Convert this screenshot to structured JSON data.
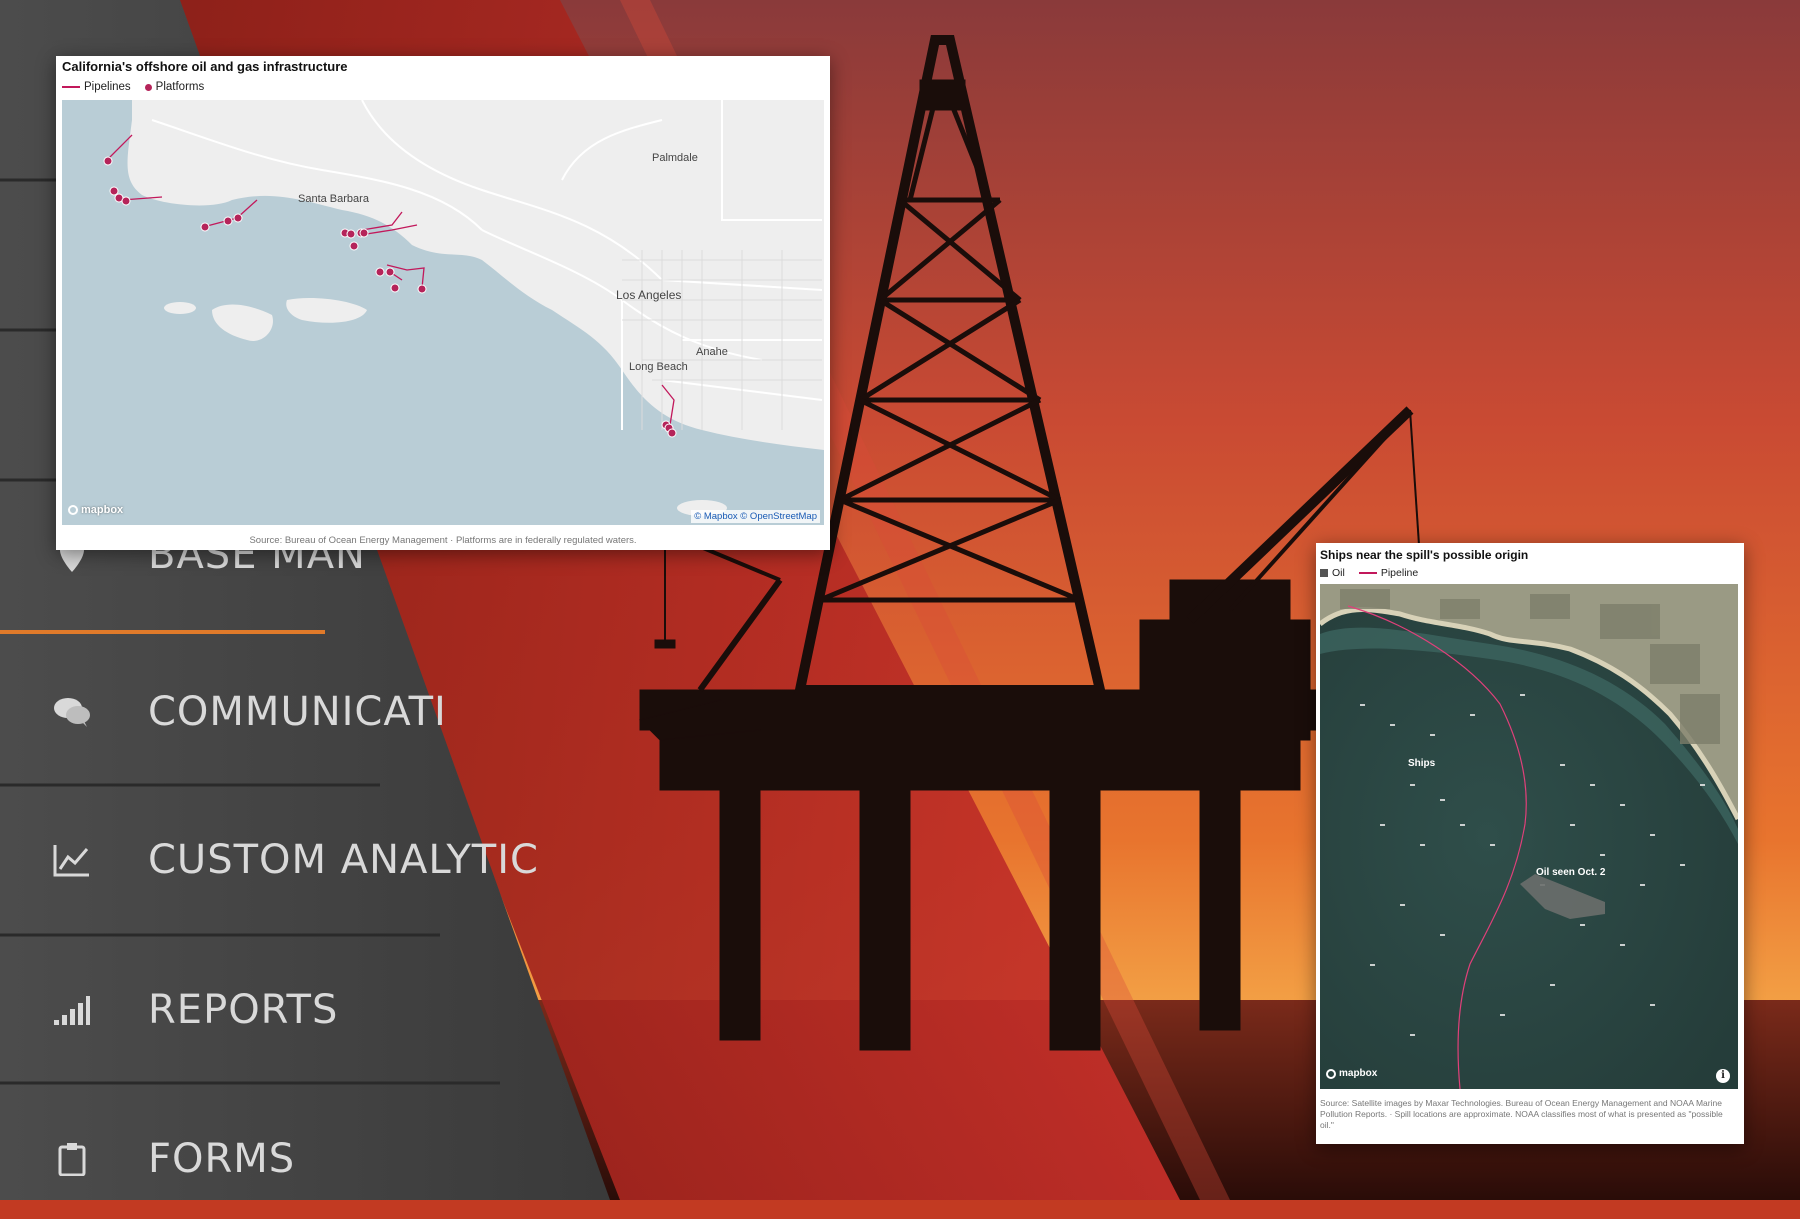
{
  "menu": {
    "items": [
      {
        "label": "BASE MAN",
        "icon": "map-pin-icon"
      },
      {
        "label": "COMMUNICATI",
        "icon": "chat-bubbles-icon"
      },
      {
        "label": "CUSTOM ANALYTIC",
        "icon": "line-chart-icon"
      },
      {
        "label": "REPORTS",
        "icon": "signal-bars-icon"
      },
      {
        "label": "FORMS",
        "icon": "clipboard-icon"
      }
    ]
  },
  "map1": {
    "title": "California's offshore oil and gas infrastructure",
    "legend": {
      "pipelines": "Pipelines",
      "platforms": "Platforms"
    },
    "cities": {
      "palmdale": "Palmdale",
      "santa_barbara": "Santa Barbara",
      "los_angeles": "Los Angeles",
      "anaheim": "Anahe",
      "long_beach": "Long Beach"
    },
    "mapbox": "mapbox",
    "attribution": "© Mapbox © OpenStreetMap",
    "source": "Source: Bureau of Ocean Energy Management  ·  Platforms are in federally regulated waters."
  },
  "map2": {
    "title": "Ships near the spill's possible origin",
    "legend": {
      "oil": "Oil",
      "pipeline": "Pipeline"
    },
    "annotations": {
      "ships": "Ships",
      "oil_seen": "Oil seen Oct. 2"
    },
    "mapbox": "mapbox",
    "info": "i",
    "source": "Source: Satellite images by Maxar Technologies. Bureau of Ocean Energy Management and NOAA Marine Pollution Reports.  ·  Spill locations are approximate. NOAA classifies most of what is presented as \"possible oil.\""
  },
  "colors": {
    "accent": "#c2185b",
    "sky_red": "#c23a22",
    "menu_gray": "#4a4a4a",
    "menu_divider": "#e07a2a"
  }
}
